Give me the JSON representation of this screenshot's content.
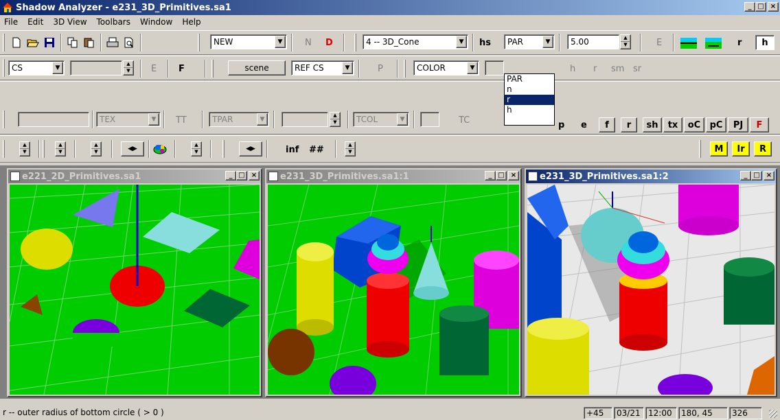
{
  "window": {
    "title": "Shadow Analyzer - e231_3D_Primitives.sa1"
  },
  "menu": [
    "File",
    "Edit",
    "3D View",
    "Toolbars",
    "Window",
    "Help"
  ],
  "toolbar1": {
    "mode_combo": "NEW",
    "n_label": "N",
    "d_label": "D",
    "primitive_combo": "4 -- 3D_Cone",
    "hs_label": "hs",
    "param_combo": "PAR",
    "value_input": "5.00",
    "e_label": "E",
    "r_label": "r",
    "h_label": "h"
  },
  "toolbar2": {
    "cs_combo": "CS",
    "e_label": "E",
    "f_label": "F",
    "scene_button": "scene",
    "refcs_combo": "REF CS",
    "p_label": "P",
    "color_combo": "COLOR",
    "h_label": "h",
    "r_label": "r",
    "sm_label": "sm",
    "sr_label": "sr"
  },
  "toolbar3": {
    "tex_combo": "TEX",
    "tt_label": "TT",
    "tpar_combo": "TPAR",
    "tcol_combo": "TCOL",
    "tc_label": "TC",
    "p_label": "p",
    "e_label": "e",
    "buttons": [
      "f",
      "r",
      "sh",
      "tx",
      "oC",
      "pC",
      "PJ",
      "F"
    ]
  },
  "toolbar4": {
    "inf_label": "inf",
    "hash_label": "##",
    "m_button": "M",
    "ir_button": "Ir",
    "r_button": "R"
  },
  "dropdown": {
    "items": [
      "PAR",
      "n",
      "r",
      "h"
    ],
    "selected_index": 2
  },
  "children": [
    {
      "title": "e221_2D_Primitives.sa1"
    },
    {
      "title": "e231_3D_Primitives.sa1:1"
    },
    {
      "title": "e231_3D_Primitives.sa1:2"
    }
  ],
  "status": {
    "text": "r -- outer radius of bottom circle ( > 0 )",
    "panels": [
      "+45",
      "03/21",
      "12:00",
      "180, 45",
      "326"
    ]
  },
  "colors": {
    "title_active": "#0a246a",
    "scene_green": "#00cc00",
    "dropdown_sel": "#0a246a"
  }
}
